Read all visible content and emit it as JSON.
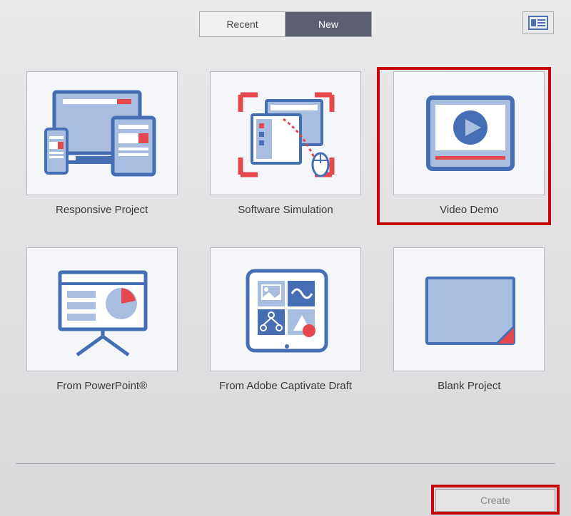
{
  "tabs": {
    "recent": "Recent",
    "new": "New"
  },
  "tiles": {
    "responsive": "Responsive Project",
    "simulation": "Software Simulation",
    "video": "Video Demo",
    "powerpoint": "From PowerPoint®",
    "draft": "From Adobe Captivate Draft",
    "blank": "Blank Project"
  },
  "footer": {
    "create": "Create"
  },
  "colors": {
    "accent_red": "#e4484d",
    "device_blue": "#466eb5",
    "soft_blue": "#a9bde1",
    "bg_panel": "#f4f6fa",
    "highlight": "#c6060a"
  }
}
